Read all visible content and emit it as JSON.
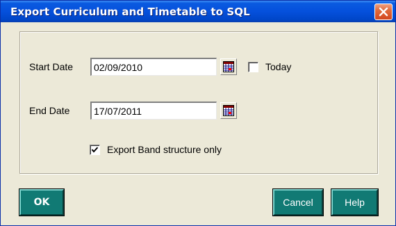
{
  "window": {
    "title": "Export Curriculum and Timetable to SQL"
  },
  "form": {
    "start_date_label": "Start Date",
    "start_date_value": "02/09/2010",
    "today_label": "Today",
    "today_checked": false,
    "end_date_label": "End Date",
    "end_date_value": "17/07/2011",
    "export_band_label": "Export Band structure only",
    "export_band_checked": true
  },
  "buttons": {
    "ok_label": "OK",
    "cancel_label": "Cancel",
    "help_label": "Help"
  },
  "icons": {
    "close": "close-icon",
    "calendar": "calendar-icon",
    "check": "checkmark-icon"
  },
  "colors": {
    "titlebar": "#0550dc",
    "close_button": "#e06a3c",
    "dialog_background": "#ece9d8",
    "button_teal": "#117a74",
    "button_text": "#ffffff"
  }
}
